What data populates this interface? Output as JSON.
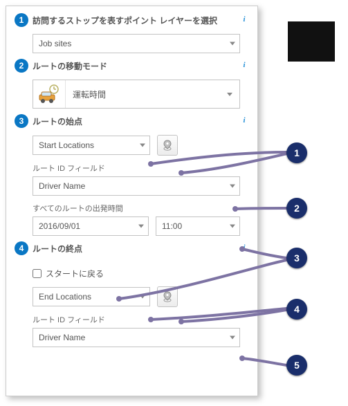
{
  "step1": {
    "num": "1",
    "title": "訪問するストップを表すポイント レイヤーを選択",
    "dropdown": "Job sites"
  },
  "step2": {
    "num": "2",
    "title": "ルートの移動モード",
    "mode": "運転時間"
  },
  "step3": {
    "num": "3",
    "title": "ルートの始点",
    "start_layer": "Start Locations",
    "id_label": "ルート ID フィールド",
    "id_field": "Driver Name",
    "depart_label": "すべてのルートの出発時間",
    "date": "2016/09/01",
    "time": "11:00"
  },
  "step4": {
    "num": "4",
    "title": "ルートの終点",
    "return_label": "スタートに戻る",
    "end_layer": "End Locations",
    "id_label": "ルート ID フィールド",
    "id_field": "Driver Name"
  },
  "callouts": {
    "b1": "1",
    "b2": "2",
    "b3": "3",
    "b4": "4",
    "b5": "5"
  }
}
